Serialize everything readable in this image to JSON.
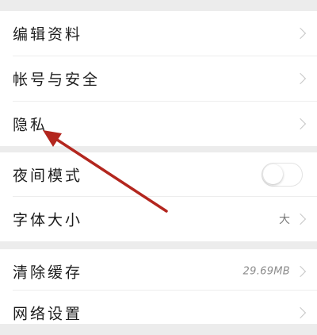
{
  "settings": {
    "group1": {
      "edit_profile": "编辑资料",
      "account_security": "帐号与安全",
      "privacy": "隐私"
    },
    "group2": {
      "night_mode": "夜间模式",
      "night_mode_enabled": false,
      "font_size": "字体大小",
      "font_size_value": "大"
    },
    "group3": {
      "clear_cache": "清除缓存",
      "cache_size": "29.69MB",
      "network_settings": "网络设置"
    }
  },
  "annotation": {
    "type": "arrow",
    "color": "#b3261e",
    "target": "privacy"
  },
  "icons": {
    "chevron": "chevron-right-icon"
  }
}
